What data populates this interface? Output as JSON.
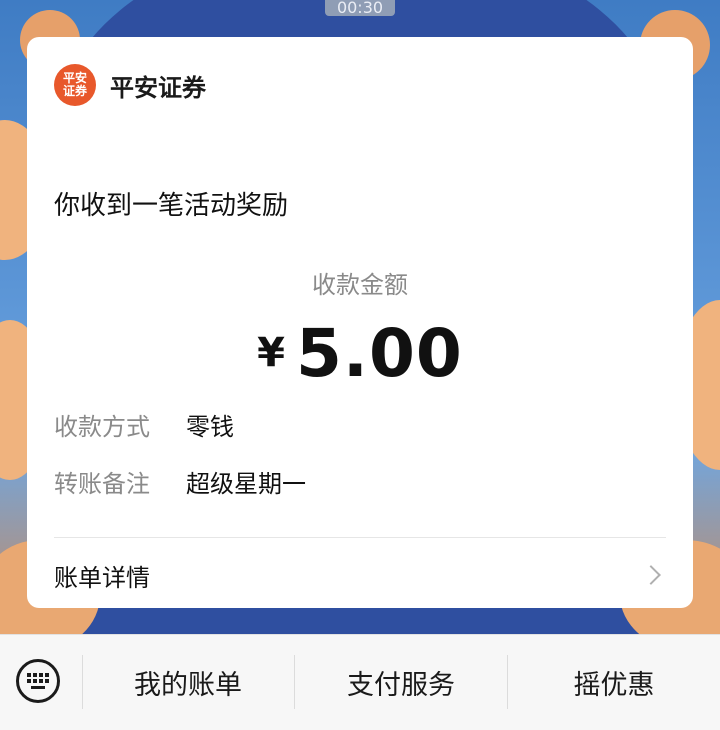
{
  "video": {
    "time": "00:30"
  },
  "card": {
    "brand_logo_text": [
      "平安",
      "证券"
    ],
    "brand_name": "平安证券",
    "headline": "你收到一笔活动奖励",
    "amount_label": "收款金额",
    "currency": "¥",
    "amount": "5.00",
    "rows": [
      {
        "key": "收款方式",
        "value": "零钱"
      },
      {
        "key": "转账备注",
        "value": "超级星期一"
      }
    ],
    "detail_label": "账单详情"
  },
  "bottom_bar": {
    "items": [
      "我的账单",
      "支付服务",
      "摇优惠"
    ]
  }
}
